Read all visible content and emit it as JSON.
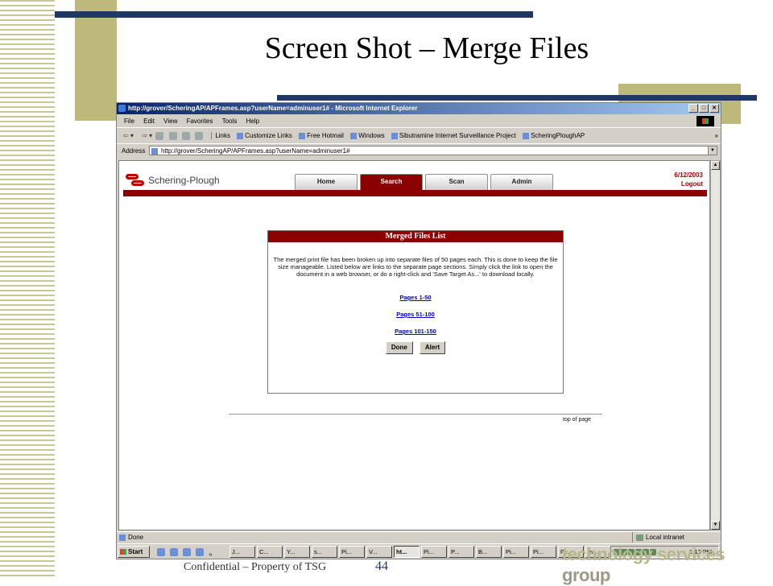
{
  "slide": {
    "title": "Screen Shot – Merge Files",
    "footer": "Confidential – Property of TSG",
    "page_number": "44",
    "logo_text": "technology services",
    "logo_text_group": "group"
  },
  "browser": {
    "window_title": "http://grover/ScheringAP/APFrames.asp?userName=adminuser1# - Microsoft Internet Explorer",
    "menu": [
      "File",
      "Edit",
      "View",
      "Favorites",
      "Tools",
      "Help"
    ],
    "links_label": "Links",
    "links": [
      "Customize Links",
      "Free Hotmail",
      "Windows",
      "Sibutramine Internet Surveillance Project",
      "ScheringPloughAP"
    ],
    "address_label": "Address",
    "address_value": "http://grover/ScheringAP/APFrames.asp?userName=adminuser1#",
    "status": "Done",
    "zone": "Local intranet"
  },
  "app": {
    "brand": "Schering-Plough",
    "tabs": [
      "Home",
      "Search",
      "Scan",
      "Admin"
    ],
    "active_tab": "Search",
    "date": "6/12/2003",
    "logout": "Logout",
    "panel": {
      "title": "Merged Files List",
      "message": "The merged print file has been broken up into separate files of 50 pages each. This is done to keep the file size manageable. Listed below are links to the separate page sections. Simply click the link to open the document in a web browser, or do a right-click and 'Save Target As...' to download locally.",
      "links": [
        "Pages 1-50",
        "Pages 51-100",
        "Pages 101-150"
      ],
      "done_button": "Done",
      "alert_button": "Alert"
    },
    "top_of_page": "top of page"
  },
  "taskbar": {
    "start": "Start",
    "tasks": [
      "J...",
      "C...",
      "Y...",
      "s...",
      "Pi...",
      "V...",
      "ht...",
      "Pi...",
      "P...",
      "B...",
      "Pi...",
      "Pi...",
      "Pi...",
      "m..."
    ],
    "active_task": "ht...",
    "clock": "1:13 PM"
  }
}
